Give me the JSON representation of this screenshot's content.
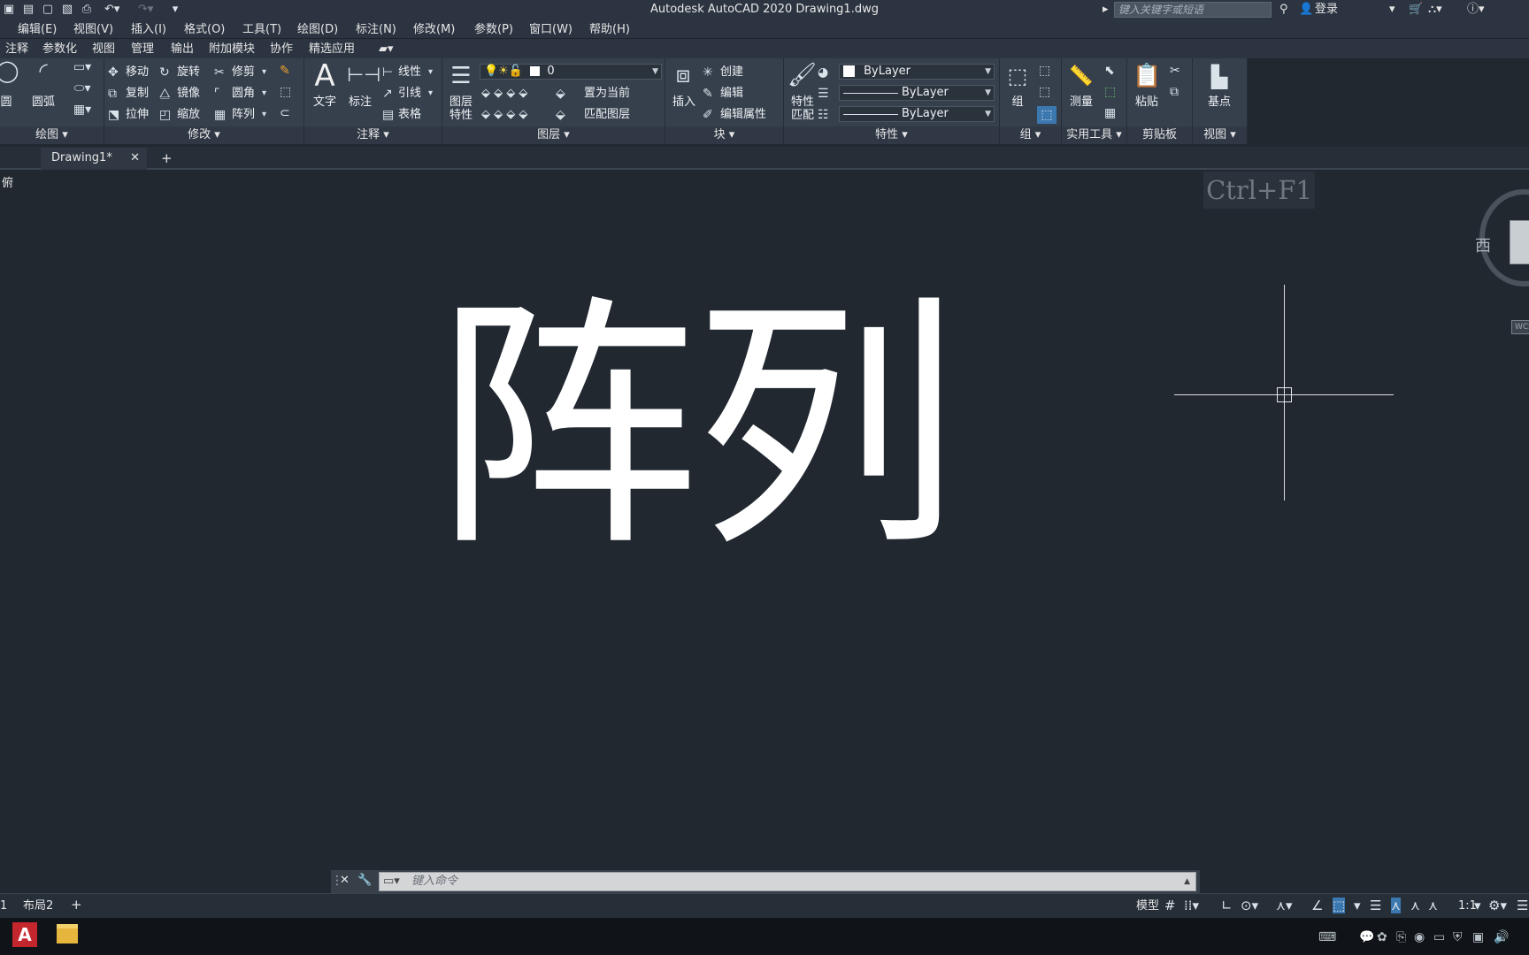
{
  "title_bar": {
    "app_title": "Autodesk AutoCAD 2020    Drawing1.dwg",
    "search_placeholder": "键入关键字或短语",
    "login_label": "登录",
    "quick_access_icons": [
      "save-icon",
      "save-as-icon",
      "new-icon",
      "open-icon",
      "print-icon",
      "undo-icon",
      "redo-icon",
      "customize-icon"
    ]
  },
  "menubar": {
    "items": [
      "编辑(E)",
      "视图(V)",
      "插入(I)",
      "格式(O)",
      "工具(T)",
      "绘图(D)",
      "标注(N)",
      "修改(M)",
      "参数(P)",
      "窗口(W)",
      "帮助(H)"
    ]
  },
  "ribbon_tabs": {
    "items": [
      "注释",
      "参数化",
      "视图",
      "管理",
      "输出",
      "附加模块",
      "协作",
      "精选应用"
    ]
  },
  "ribbon": {
    "draw": {
      "label": "绘图",
      "circle": "圆",
      "arc": "圆弧"
    },
    "modify": {
      "label": "修改",
      "move": "移动",
      "rotate": "旋转",
      "trim": "修剪",
      "copy": "复制",
      "mirror": "镜像",
      "fillet": "圆角",
      "stretch": "拉伸",
      "scale": "缩放",
      "array": "阵列"
    },
    "annotation": {
      "label": "注释",
      "text": "文字",
      "dimension": "标注",
      "linear": "线性",
      "leader": "引线",
      "table": "表格"
    },
    "layers": {
      "label": "图层",
      "layer_props": "图层特性",
      "current_layer": "0",
      "set_current": "置为当前",
      "match_layer": "匹配图层"
    },
    "block": {
      "label": "块",
      "insert": "插入",
      "create": "创建",
      "edit": "编辑",
      "edit_attr": "编辑属性"
    },
    "properties": {
      "label": "特性",
      "match": "特性匹配",
      "color": "ByLayer",
      "linetype": "ByLayer",
      "lineweight": "ByLayer"
    },
    "groups": {
      "label": "组",
      "group": "组"
    },
    "utilities": {
      "label": "实用工具",
      "measure": "测量"
    },
    "clipboard": {
      "label": "剪贴板",
      "paste": "粘贴"
    },
    "view": {
      "label": "视图",
      "base": "基点"
    }
  },
  "doc_tabs": {
    "active": "Drawing1*"
  },
  "canvas": {
    "viewport_label": "俯",
    "drawing_text": "阵列",
    "tooltip": "Ctrl+F1",
    "viewcube_west": "西",
    "wcs_label": "WCS"
  },
  "command_line": {
    "placeholder": "键入命令"
  },
  "status": {
    "layout_tabs": [
      "1",
      "布局2"
    ],
    "model_label": "模型",
    "scale_label": "1:1"
  },
  "colors": {
    "canvas_bg": "#212830",
    "ribbon_bg": "#36404d",
    "title_bg": "#2b3440",
    "taskbar_bg": "#101418",
    "autocad_red": "#c4262e"
  }
}
